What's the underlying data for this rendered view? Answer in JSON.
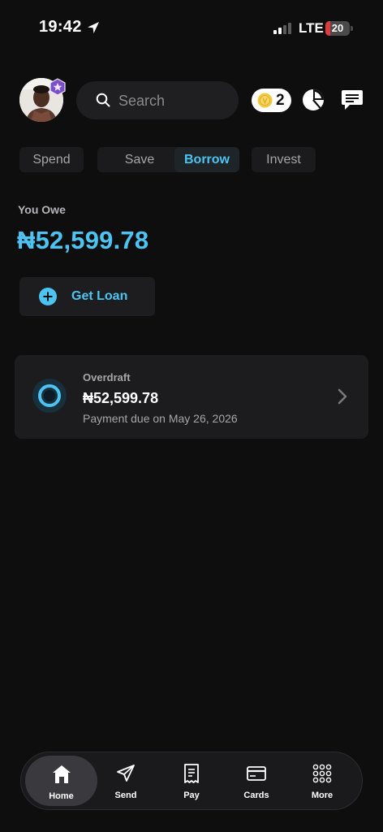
{
  "status_bar": {
    "time": "19:42",
    "network": "LTE",
    "battery_level": "20",
    "battery_fill": 0.2,
    "battery_color": "#e0393e"
  },
  "header": {
    "search_placeholder": "Search",
    "coins_count": "2",
    "icons": [
      "avatar",
      "avatar-badge-icon",
      "search-icon",
      "coin-icon",
      "chart-icon",
      "chat-icon"
    ]
  },
  "tabs": [
    {
      "label": "Spend",
      "active": false
    },
    {
      "label": "Save",
      "active": false
    },
    {
      "label": "Borrow",
      "active": true
    },
    {
      "label": "Invest",
      "active": false
    }
  ],
  "summary": {
    "owe_label": "You Owe",
    "owe_amount": "₦52,599.78"
  },
  "actions": {
    "get_loan_label": "Get Loan"
  },
  "loan_card": {
    "title": "Overdraft",
    "amount": "₦52,599.78",
    "due": "Payment due on May 26, 2026"
  },
  "bottom_nav": [
    {
      "label": "Home",
      "icon": "home-icon",
      "active": true
    },
    {
      "label": "Send",
      "icon": "send-icon",
      "active": false
    },
    {
      "label": "Pay",
      "icon": "receipt-icon",
      "active": false
    },
    {
      "label": "Cards",
      "icon": "card-icon",
      "active": false
    },
    {
      "label": "More",
      "icon": "grid-icon",
      "active": false
    }
  ],
  "colors": {
    "accent": "#4cc3f0",
    "background": "#0e0e0e",
    "surface": "#1c1c1f"
  }
}
